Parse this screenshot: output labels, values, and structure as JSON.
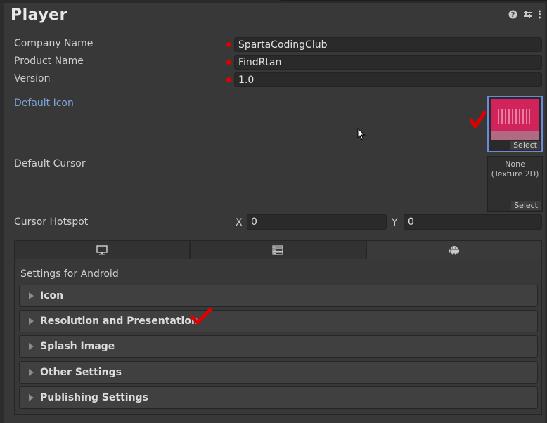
{
  "header": {
    "title": "Player"
  },
  "fields": {
    "company_label": "Company Name",
    "company_value": "SpartaCodingClub",
    "product_label": "Product Name",
    "product_value": "FindRtan",
    "version_label": "Version",
    "version_value": "1.0"
  },
  "default_icon": {
    "label": "Default Icon",
    "select_label": "Select"
  },
  "default_cursor": {
    "label": "Default Cursor",
    "none_line1": "None",
    "none_line2": "(Texture 2D)",
    "select_label": "Select"
  },
  "cursor_hotspot": {
    "label": "Cursor Hotspot",
    "x_label": "X",
    "x_value": "0",
    "y_label": "Y",
    "y_value": "0"
  },
  "platform_tabs": [
    {
      "icon": "monitor-icon",
      "active": false
    },
    {
      "icon": "server-icon",
      "active": false
    },
    {
      "icon": "android-icon",
      "active": true
    }
  ],
  "settings_title": "Settings for Android",
  "sections": [
    {
      "label": "Icon"
    },
    {
      "label": "Resolution and Presentation"
    },
    {
      "label": "Splash Image"
    },
    {
      "label": "Other Settings"
    },
    {
      "label": "Publishing Settings"
    }
  ],
  "colors": {
    "background": "#383838",
    "field_bg": "#2a2a2a",
    "link_blue": "#7ea4d8",
    "annotation_red": "#e00000",
    "icon_pink": "#d2245c",
    "selection_blue": "#6b8ad8"
  }
}
